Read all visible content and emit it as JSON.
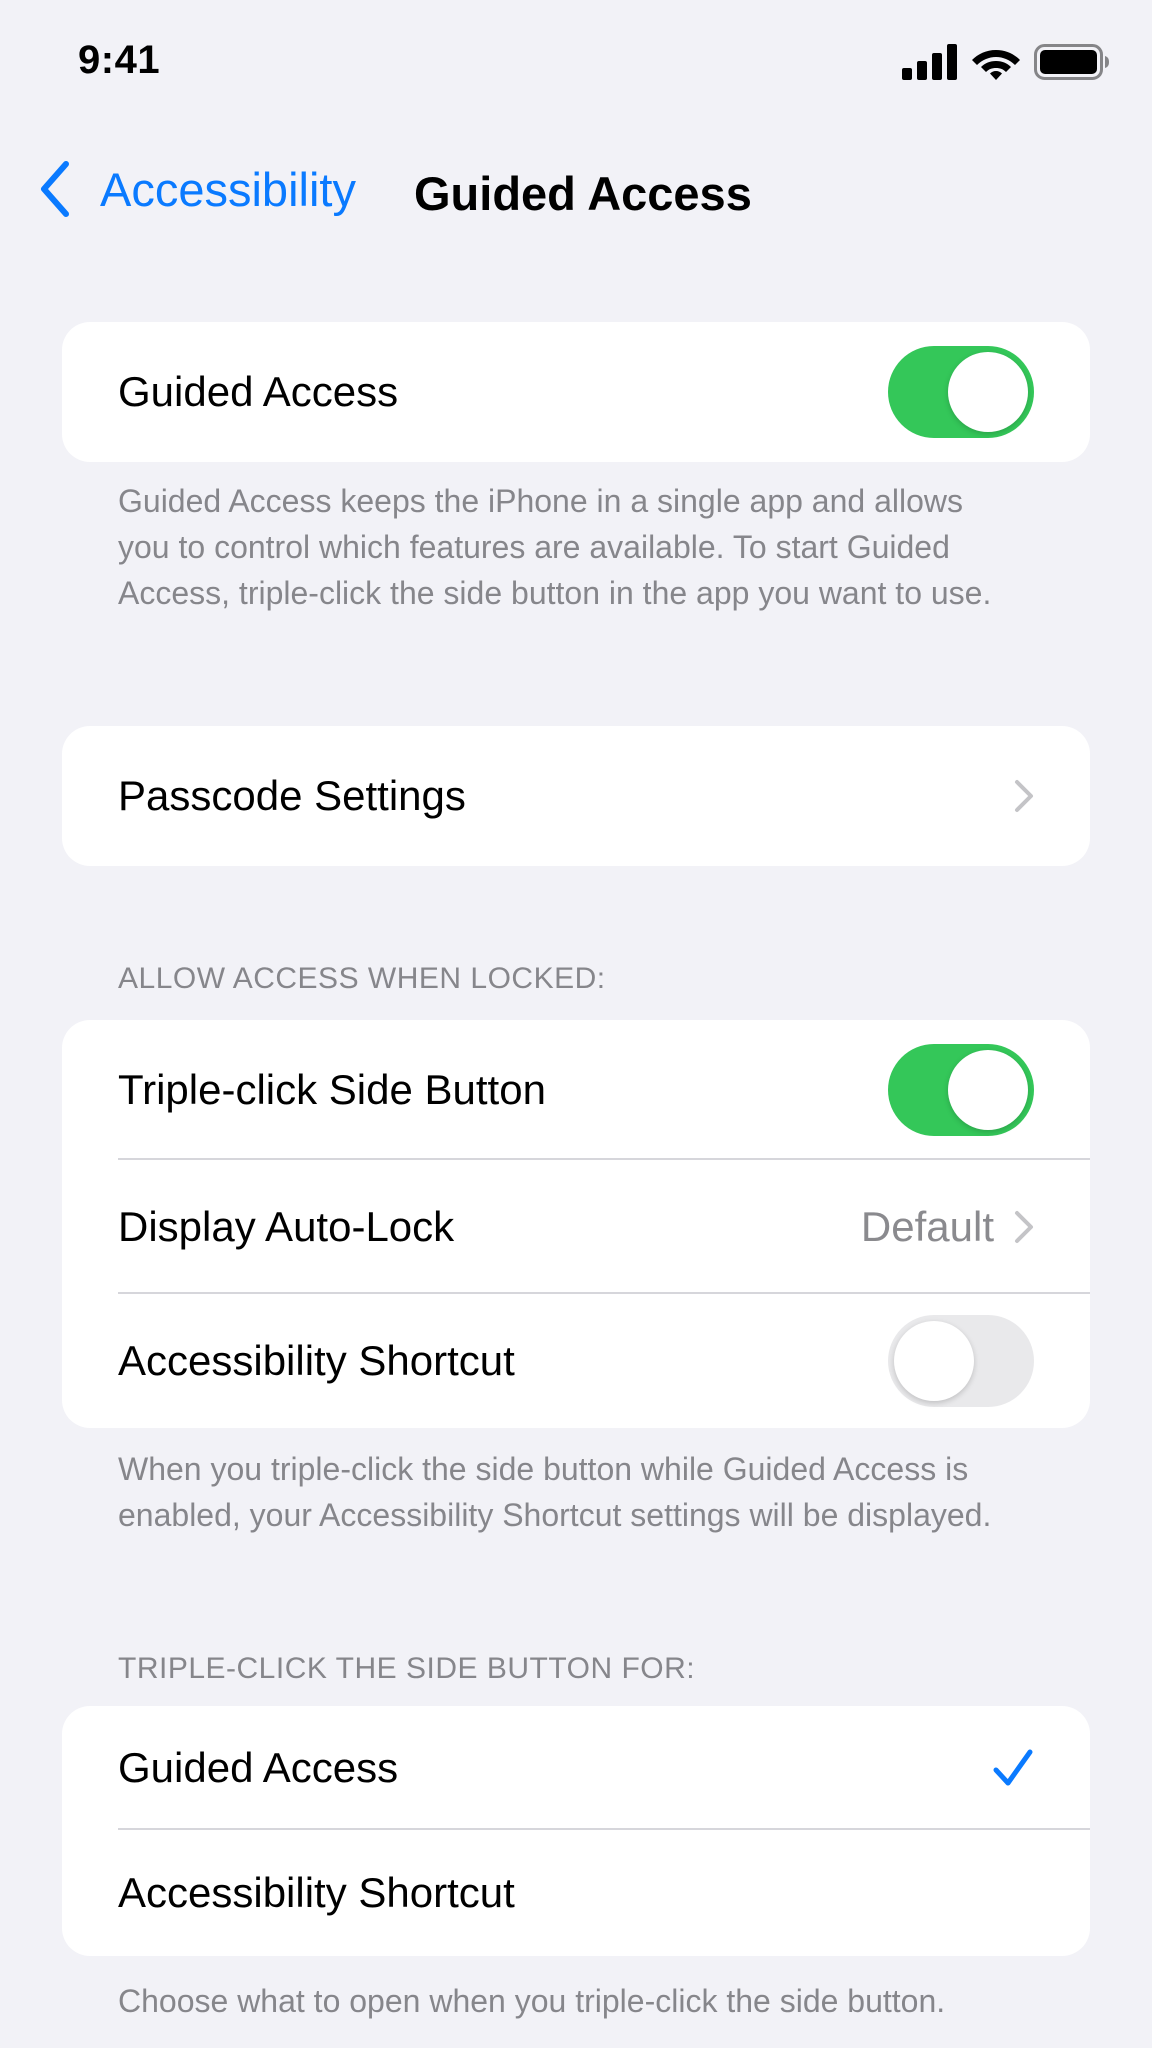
{
  "status_bar": {
    "time": "9:41",
    "icons": [
      "cellular-signal-icon",
      "wifi-icon",
      "battery-icon"
    ]
  },
  "nav": {
    "back_label": "Accessibility",
    "title": "Guided Access"
  },
  "colors": {
    "accent": "#0a7aff",
    "toggle_on": "#34c759",
    "toggle_off": "#e9e9eb",
    "background": "#f2f2f7",
    "secondary_text": "#86868b"
  },
  "main_toggle": {
    "label": "Guided Access",
    "on": true
  },
  "main_footer": "Guided Access keeps the iPhone in a single app and allows you to control which features are available. To start Guided Access, triple-click the side button in the app you want to use.",
  "passcode": {
    "label": "Passcode Settings"
  },
  "locked_section": {
    "header": "ALLOW ACCESS WHEN LOCKED:",
    "rows": [
      {
        "label": "Triple-click Side Button",
        "toggle": true
      },
      {
        "label": "Display Auto-Lock",
        "value": "Default"
      },
      {
        "label": "Accessibility Shortcut",
        "toggle": false
      }
    ],
    "footer": "When you triple-click the side button while Guided Access is enabled, your Accessibility Shortcut settings will be displayed."
  },
  "triple_click_section": {
    "header": "TRIPLE-CLICK THE SIDE BUTTON FOR:",
    "options": [
      {
        "label": "Guided Access",
        "selected": true
      },
      {
        "label": "Accessibility Shortcut",
        "selected": false
      }
    ],
    "footer": "Choose what to open when you triple-click the side button."
  }
}
